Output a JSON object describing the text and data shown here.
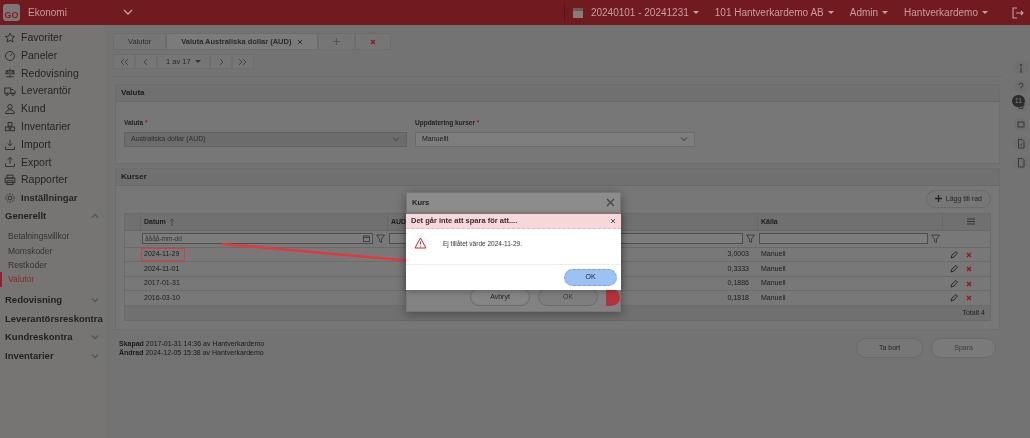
{
  "navbar": {
    "logo": "GO",
    "app": "Ekonomi",
    "period": "20240101 - 20241231",
    "company": "101 Hantverkardemo AB",
    "role": "Admin",
    "user": "Hantverkardemo"
  },
  "sidebar": {
    "items": [
      {
        "label": "Favoriter"
      },
      {
        "label": "Paneler"
      },
      {
        "label": "Redovisning"
      },
      {
        "label": "Leverantör"
      },
      {
        "label": "Kund"
      },
      {
        "label": "Inventarier"
      },
      {
        "label": "Import"
      },
      {
        "label": "Export"
      },
      {
        "label": "Rapporter"
      }
    ],
    "settings": {
      "label": "Inställningar",
      "groups": [
        {
          "label": "Generellt",
          "expanded": true,
          "children": [
            {
              "label": "Betalningsvillkor",
              "selected": false
            },
            {
              "label": "Momskoder",
              "selected": false
            },
            {
              "label": "Restkoder",
              "selected": false
            },
            {
              "label": "Valutor",
              "selected": true
            }
          ]
        },
        {
          "label": "Redovisning",
          "expanded": false
        },
        {
          "label": "Leverantörsreskontra",
          "expanded": false
        },
        {
          "label": "Kundreskontra",
          "expanded": false
        },
        {
          "label": "Inventarier",
          "expanded": false
        }
      ]
    }
  },
  "tabs": [
    {
      "label": "Valutor",
      "selected": false,
      "closable": false
    },
    {
      "label": "Valuta Australiska dollar (AUD)",
      "selected": true,
      "closable": true
    }
  ],
  "pager": {
    "label": "1 av 17"
  },
  "valuta_card": {
    "title": "Valuta",
    "fields": [
      {
        "label": "Valuta",
        "marker": "*",
        "value": "Australiska dollar (AUD)",
        "disabled": true
      },
      {
        "label": "Uppdatering kurser",
        "marker": "*",
        "value": "Manuellt",
        "disabled": false
      }
    ]
  },
  "kurser_card": {
    "title": "Kurser",
    "add_button": "Lägg till rad",
    "columns": [
      {
        "label": "Datum",
        "sorted": true,
        "kind": "date"
      },
      {
        "label": "AUD",
        "kind": "text"
      },
      {
        "label": "Källa",
        "kind": "text"
      }
    ],
    "date_placeholder": "åååå-mm-dd",
    "rows": [
      {
        "date": "2024-11-29",
        "rate": "3,0003",
        "source": "Manuell",
        "highlighted": true
      },
      {
        "date": "2024-11-01",
        "rate": "0,3333",
        "source": "Manuell",
        "highlighted": false
      },
      {
        "date": "2017-01-31",
        "rate": "0,1886",
        "source": "Manuell",
        "highlighted": false
      },
      {
        "date": "2016-03-10",
        "rate": "0,1818",
        "source": "Manuell",
        "highlighted": false
      }
    ],
    "total": "Totalt 4"
  },
  "footer": {
    "notes": [
      "**Skapad** 2017-01-31 14:36 av Hantverkardemo",
      "**Ändrad** 2024-12-05 15:38 av Hantverkardemo"
    ],
    "buttons": [
      {
        "label": "Ta bort",
        "disabled": false
      },
      {
        "label": "Spara",
        "disabled": true
      }
    ]
  },
  "right_rail": {
    "badge": "11"
  },
  "kurs_modal": {
    "title": "Kurs",
    "buttons": [
      {
        "label": "Avbryt",
        "disabled": false
      },
      {
        "label": "OK",
        "disabled": true
      }
    ]
  },
  "alert": {
    "title": "Det går inte att spara för att....",
    "message": "Ej tillåtet värde 2024-11-29.",
    "ok": "OK"
  }
}
